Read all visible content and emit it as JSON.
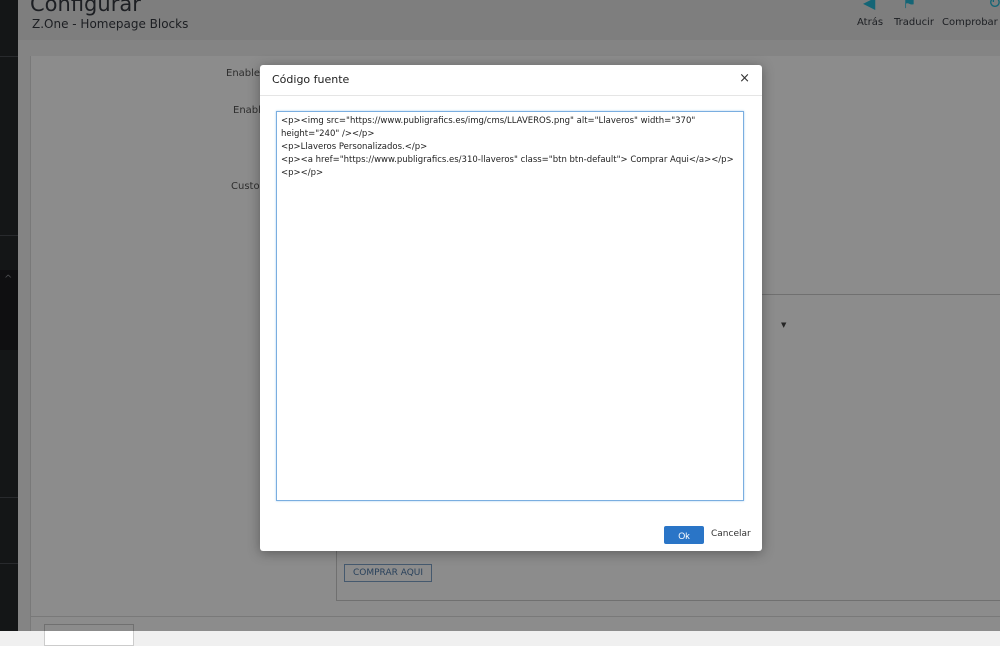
{
  "header": {
    "title": "Configurar",
    "breadcrumb": "Z.One - Homepage Blocks",
    "toolbar": [
      {
        "label": "Atrás",
        "icon": "back-icon"
      },
      {
        "label": "Traducir",
        "icon": "flag-icon"
      },
      {
        "label": "Comprobar a",
        "icon": "refresh-icon"
      }
    ]
  },
  "form": {
    "label_enable": "Enable",
    "label_enable2": "Enabl",
    "label_custom": "Custo",
    "comprar_label": "COMPRAR AQUI"
  },
  "modal": {
    "title": "Código fuente",
    "close": "×",
    "code": "<p><img src=\"https://www.publigrafics.es/img/cms/LLAVEROS.png\" alt=\"Llaveros\" width=\"370\"\nheight=\"240\" /></p>\n<p>Llaveros Personalizados.</p>\n<p><a href=\"https://www.publigrafics.es/310-llaveros\" class=\"btn btn-default\"> Comprar Aqui</a></p>\n<p></p>",
    "ok": "Ok",
    "cancel": "Cancelar"
  },
  "colors": {
    "accent": "#25b9d7",
    "primary_button": "#2a75c7"
  }
}
